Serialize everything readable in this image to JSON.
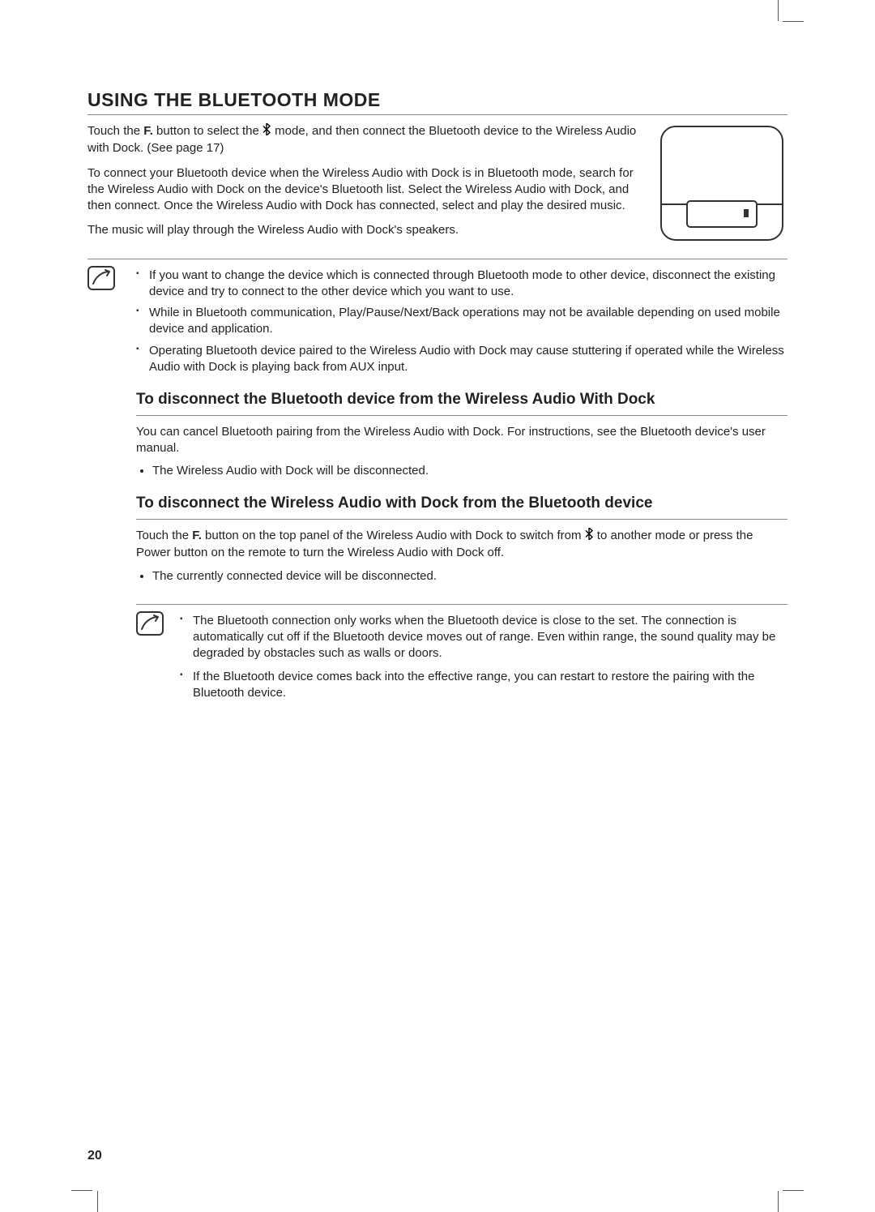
{
  "page_number": "20",
  "heading": "USING THE BLUETOOTH MODE",
  "intro": {
    "p1_pre": "Touch the ",
    "p1_bold": "F.",
    "p1_mid": " button to select the ",
    "p1_post": " mode, and then connect the Bluetooth device to the Wireless Audio with Dock. (See page 17)",
    "p2": "To connect your Bluetooth device when the Wireless Audio with Dock is in Bluetooth mode, search for the Wireless Audio with Dock on the device's Bluetooth list. Select the Wireless Audio with Dock, and then connect. Once the Wireless Audio with Dock has connected, select and play the desired music.",
    "p3": "The music will play through the Wireless Audio with Dock's speakers."
  },
  "notes1": [
    "If you want to change the device which is connected through Bluetooth mode to other device, disconnect the existing device and try to connect to the other device which you want to use.",
    "While in Bluetooth communication, Play/Pause/Next/Back operations may not be available depending on used mobile device and application.",
    "Operating Bluetooth device paired to the Wireless Audio with Dock may cause stuttering if operated while the Wireless Audio with Dock is playing back from AUX input."
  ],
  "sub1": {
    "title": "To disconnect the Bluetooth device from the Wireless Audio With Dock",
    "p1": "You can cancel Bluetooth pairing from the Wireless Audio with Dock. For instructions, see the Bluetooth device's user manual.",
    "bullets": [
      "The Wireless Audio with Dock will be disconnected."
    ]
  },
  "sub2": {
    "title": "To disconnect the Wireless Audio with Dock from the Bluetooth device",
    "p1_pre": "Touch the ",
    "p1_bold": "F.",
    "p1_mid": " button on the top panel of the Wireless Audio with Dock to switch from ",
    "p1_post": " to another mode or press the Power button on the remote to turn the Wireless Audio with Dock off.",
    "bullets": [
      "The currently connected device will be disconnected."
    ]
  },
  "notes2": [
    "The Bluetooth connection only works when the Bluetooth device is close to the set. The connection is automatically cut off if the Bluetooth device moves out of range. Even within range, the sound quality may be degraded by obstacles such as walls or doors.",
    "If the Bluetooth device comes back into the effective range, you can restart to restore the pairing with the Bluetooth device."
  ]
}
